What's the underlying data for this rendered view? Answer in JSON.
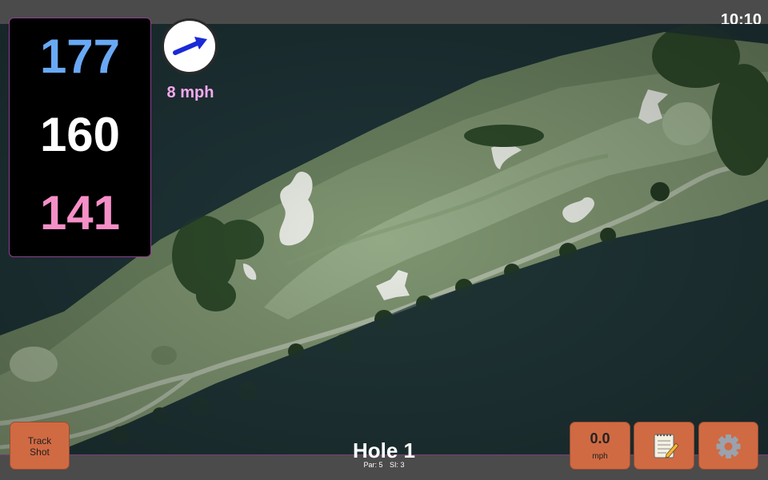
{
  "status": {
    "time": "10:10"
  },
  "distances": {
    "back": "177",
    "middle": "160",
    "front": "141"
  },
  "wind": {
    "speed": "8 mph",
    "direction_icon": "wind-arrow-icon"
  },
  "hole": {
    "title": "Hole 1",
    "par": "Par: 5",
    "stroke_index": "SI: 3"
  },
  "buttons": {
    "track_shot_line1": "Track",
    "track_shot_line2": "Shot",
    "speed_value": "0.0",
    "speed_unit": "mph",
    "notes_icon": "notepad-icon",
    "settings_icon": "gear-icon"
  },
  "colors": {
    "back_distance": "#69a9f4",
    "middle_distance": "#ffffff",
    "front_distance": "#f58fc7",
    "wind_text": "#f6a8ef",
    "button": "#d06a43",
    "accent_border": "#8e3f8e"
  }
}
